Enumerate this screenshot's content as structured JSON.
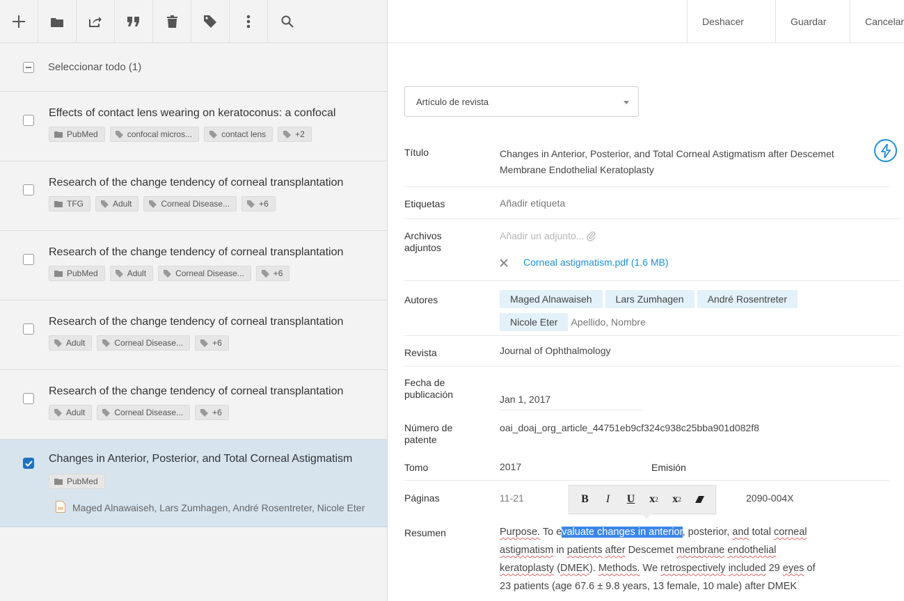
{
  "toolbar": {
    "icons": [
      "plus-icon",
      "folder-icon",
      "share-icon",
      "quote-icon",
      "trash-icon",
      "tag-icon",
      "more-vertical-icon",
      "search-icon"
    ]
  },
  "list": {
    "select_all": "Seleccionar todo (1)",
    "items": [
      {
        "title": "Effects of contact lens wearing on keratoconus: a confocal",
        "tags": [
          "PubMed",
          "confocal micros...",
          "contact lens",
          "+2"
        ]
      },
      {
        "title": "Research of the change tendency of corneal transplantation",
        "tags": [
          "TFG",
          "Adult",
          "Corneal Disease...",
          "+6"
        ]
      },
      {
        "title": "Research of the change tendency of corneal transplantation",
        "tags": [
          "PubMed",
          "Adult",
          "Corneal Disease...",
          "+6"
        ]
      },
      {
        "title": "Research of the change tendency of corneal transplantation",
        "tags": [
          "Adult",
          "Corneal Disease...",
          "+6"
        ]
      },
      {
        "title": "Research of the change tendency of corneal transplantation",
        "tags": [
          "Adult",
          "Corneal Disease...",
          "+6"
        ]
      },
      {
        "title": "Changes in Anterior, Posterior, and Total Corneal Astigmatism",
        "tags": [
          "PubMed"
        ],
        "authors": "Maged Alnawaiseh, Lars Zumhagen, André Rosentreter, Nicole Eter"
      }
    ]
  },
  "actions": {
    "undo": "Deshacer",
    "save": "Guardar",
    "cancel": "Cancelar"
  },
  "form": {
    "type_value": "Artículo de revista",
    "labels": {
      "title": "Título",
      "tags": "Etiquetas",
      "attachments": "Archivos adjuntos",
      "authors": "Autores",
      "journal": "Revista",
      "pub_date": "Fecha de publicación",
      "patent": "Número de patente",
      "volume": "Tomo",
      "issue": "Emisión",
      "pages": "Páginas",
      "abstract": "Resumen"
    },
    "title_value": "Changes in Anterior, Posterior, and Total Corneal Astigmatism after Descemet Membrane Endothelial Keratoplasty",
    "tags_placeholder": "Añadir etiqueta",
    "attach_placeholder": "Añadir un adjunto...",
    "attachment_file": "Corneal astigmatism.pdf (1.6 MB)",
    "authors": [
      "Maged Alnawaiseh",
      "Lars Zumhagen",
      "André Rosentreter",
      "Nicole Eter"
    ],
    "author_placeholder": "Apellido, Nombre",
    "journal_value": "Journal of Ophthalmology",
    "pub_date_value": "Jan 1, 2017",
    "patent_value": "oai_doaj_org_article_44751eb9cf324c938c25bba901d082f8",
    "volume_value": "2017",
    "pages_value": "11-21",
    "issn_value": "2090-004X",
    "abstract": {
      "w1": "Purpose.",
      "w2": " To e",
      "selected": "valuate changes in anterior",
      "w3": ", posterior, ",
      "w4": "and",
      "w5": " total ",
      "w6": "corneal",
      "w7": "astigmatism",
      "w8": " in ",
      "w9": "patients",
      "w10": " ",
      "w11": "after",
      "w12": " Descemet ",
      "w13": "membrane",
      "w14": " ",
      "w15": "endothelial",
      "w16": "keratoplasty",
      "w17": " (",
      "w18": "DMEK",
      "w19": "). ",
      "w20": "Methods.",
      "w21": " We ",
      "w22": "retrospectively",
      "w23": " ",
      "w24": "included",
      "w25": " 29 ",
      "w26": "eyes",
      "w27": " of",
      "w28": "23 patients (age 67.6 ± 9.8 years, 13 female, 10 male) after DMEK"
    }
  },
  "format_toolbar": {
    "bold": "B",
    "italic": "I",
    "underline": "U",
    "sup_base": "x",
    "sup": "2",
    "sub_base": "x",
    "sub": "2"
  }
}
